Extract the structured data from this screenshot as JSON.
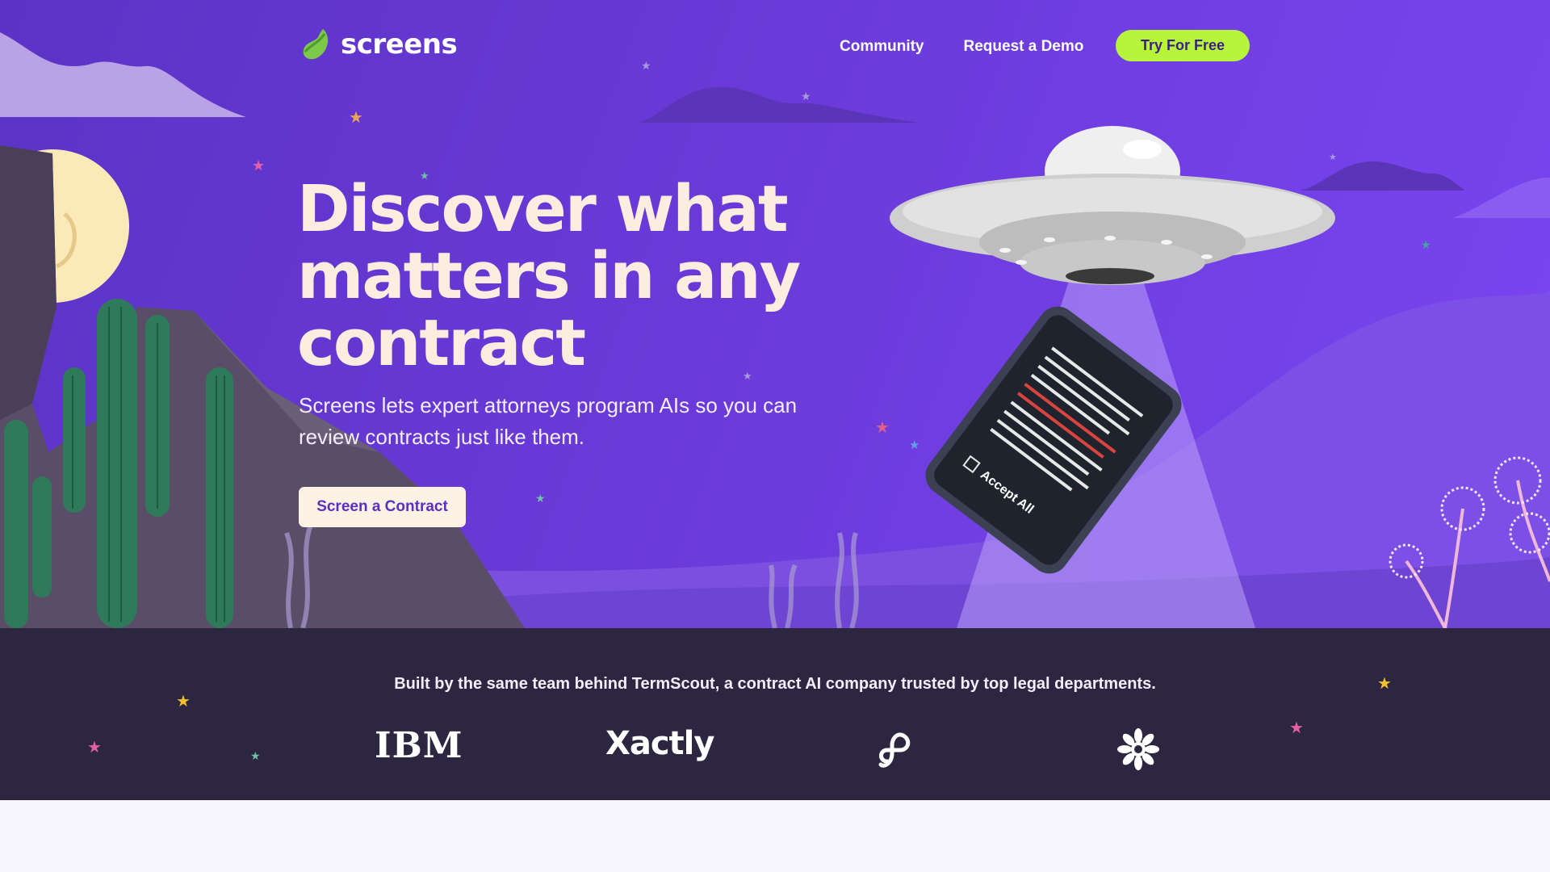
{
  "brand": {
    "name": "screens",
    "logo_icon": "leaf-logo-icon",
    "accent": "#b7f53c"
  },
  "nav": {
    "links": [
      {
        "label": "Community"
      },
      {
        "label": "Request a Demo"
      }
    ],
    "cta_label": "Try For Free"
  },
  "hero": {
    "headline_lines": [
      "Discover what",
      "matters in any",
      "contract"
    ],
    "subtitle": "Screens lets expert attorneys program AIs so you can review contracts just like them.",
    "cta_label": "Screen a Contract",
    "phone_label": "Accept All",
    "background_color": "#6a3ad8"
  },
  "trust": {
    "text": "Built by the same team behind TermScout, a contract AI company trusted by top legal departments.",
    "logos": [
      {
        "name": "IBM",
        "icon": "ibm-logo"
      },
      {
        "name": "Xactly",
        "icon": "xactly-logo"
      },
      {
        "name": "",
        "icon": "infinity-loop-logo-icon"
      },
      {
        "name": "",
        "icon": "starburst-flower-logo-icon"
      }
    ],
    "background_color": "#2d2640"
  }
}
